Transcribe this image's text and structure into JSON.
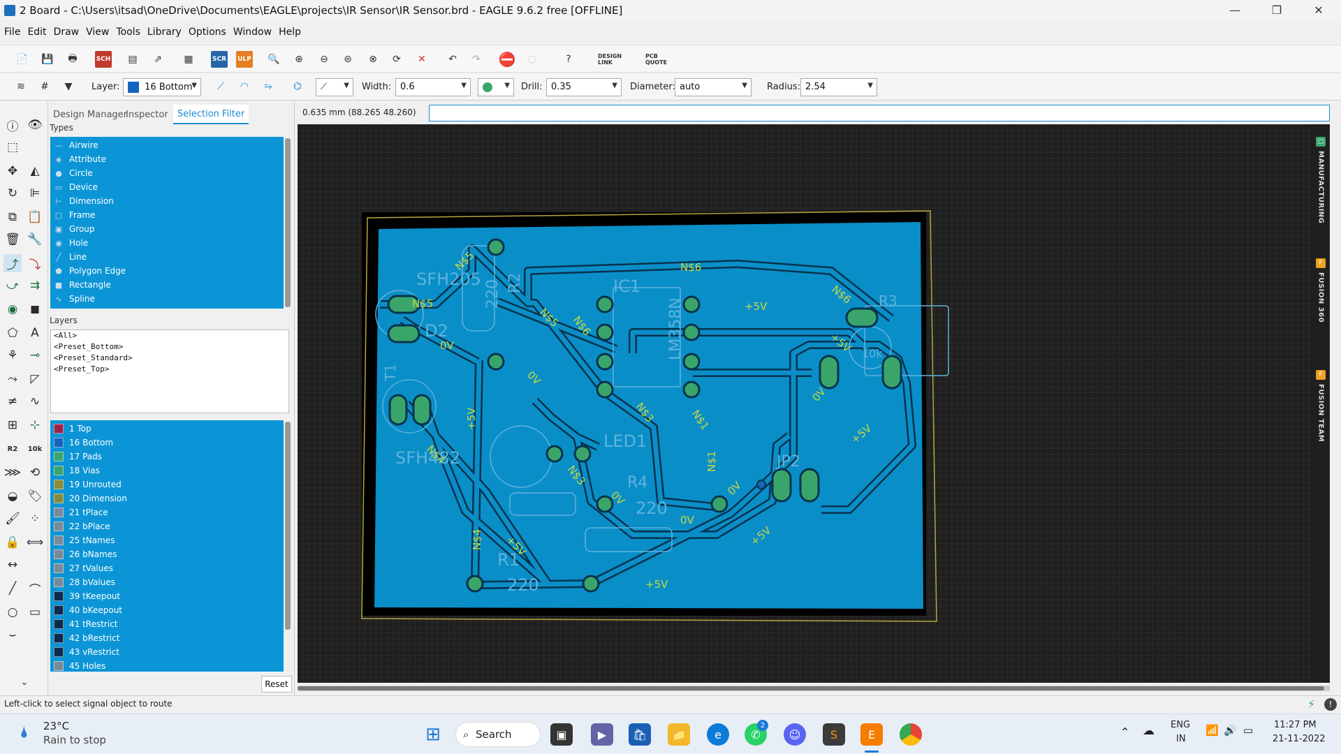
{
  "window": {
    "title": "2 Board - C:\\Users\\itsad\\OneDrive\\Documents\\EAGLE\\projects\\IR Sensor\\IR Sensor.brd - EAGLE 9.6.2 free [OFFLINE]",
    "minimize": "—",
    "maximize": "❐",
    "close": "✕"
  },
  "menu": [
    "File",
    "Edit",
    "Draw",
    "View",
    "Tools",
    "Library",
    "Options",
    "Window",
    "Help"
  ],
  "toolbar": {
    "scr": "SCR",
    "ulp": "ULP",
    "sch": "SCH",
    "design_link": "DESIGN LINK",
    "pcb_quote": "PCB QUOTE",
    "help": "?"
  },
  "params": {
    "layer_label": "Layer:",
    "layer_value": "16 Bottom",
    "layer_color": "#1565c0",
    "width_label": "Width:",
    "width_value": "0.6",
    "drill_label": "Drill:",
    "drill_value": "0.35",
    "diameter_label": "Diameter:",
    "diameter_value": "auto",
    "radius_label": "Radius:",
    "radius_value": "2.54"
  },
  "panel": {
    "tabs": [
      "Design Manager",
      "Inspector",
      "Selection Filter"
    ],
    "types_title": "Types",
    "types": [
      {
        "label": "Airwire",
        "icon": "—"
      },
      {
        "label": "Attribute",
        "icon": "◈"
      },
      {
        "label": "Circle",
        "icon": "●"
      },
      {
        "label": "Device",
        "icon": "▭"
      },
      {
        "label": "Dimension",
        "icon": "⊢"
      },
      {
        "label": "Frame",
        "icon": "▢"
      },
      {
        "label": "Group",
        "icon": "▣"
      },
      {
        "label": "Hole",
        "icon": "◉"
      },
      {
        "label": "Line",
        "icon": "╱"
      },
      {
        "label": "Polygon Edge",
        "icon": "⬟"
      },
      {
        "label": "Rectangle",
        "icon": "■"
      },
      {
        "label": "Spline",
        "icon": "∿"
      }
    ],
    "layers_title": "Layers",
    "presets": [
      "<All>",
      "<Preset_Bottom>",
      "<Preset_Standard>",
      "<Preset_Top>"
    ],
    "layers": [
      {
        "label": "1 Top",
        "color": "#a0204a"
      },
      {
        "label": "16 Bottom",
        "color": "#1565c0"
      },
      {
        "label": "17 Pads",
        "color": "#3aa56b"
      },
      {
        "label": "18 Vias",
        "color": "#3aa56b"
      },
      {
        "label": "19 Unrouted",
        "color": "#8a8a3a"
      },
      {
        "label": "20 Dimension",
        "color": "#8a8a3a"
      },
      {
        "label": "21 tPlace",
        "color": "#7a8a9a"
      },
      {
        "label": "22 bPlace",
        "color": "#7a8a9a"
      },
      {
        "label": "25 tNames",
        "color": "#7a8a9a"
      },
      {
        "label": "26 bNames",
        "color": "#7a8a9a"
      },
      {
        "label": "27 tValues",
        "color": "#7a8a9a"
      },
      {
        "label": "28 bValues",
        "color": "#7a8a9a"
      },
      {
        "label": "39 tKeepout",
        "color": "#0d2b4a"
      },
      {
        "label": "40 bKeepout",
        "color": "#0d2b4a"
      },
      {
        "label": "41 tRestrict",
        "color": "#0d2b4a"
      },
      {
        "label": "42 bRestrict",
        "color": "#0d2b4a"
      },
      {
        "label": "43 vRestrict",
        "color": "#0d2b4a"
      },
      {
        "label": "45 Holes",
        "color": "#7a8a9a"
      }
    ],
    "reset": "Reset"
  },
  "coord": "0.635 mm (88.265 48.260)",
  "side_tabs": [
    {
      "label": "MANUFACTURING",
      "badge": "▢",
      "color": "#3aa56b"
    },
    {
      "label": "FUSION 360",
      "badge": "F",
      "color": "#f0a020"
    },
    {
      "label": "FUSION TEAM",
      "badge": "F",
      "color": "#f0a020"
    }
  ],
  "board": {
    "labels": {
      "sfh205": "SFH205",
      "d2": "D2",
      "ic1": "IC1",
      "lm358n": "LM358N",
      "r2": "R2",
      "r2_value": "220",
      "led1": "LED1",
      "r4": "R4",
      "r4_value": "220",
      "jp2": "JP2",
      "r1": "R1",
      "r1_value": "220",
      "sfh482": "SFH482",
      "r3": "R3",
      "r3_value": "10k",
      "t1": "T1",
      "n5_a": "N$5",
      "n5_b": "N$5",
      "n5_c": "N$5",
      "n6_a": "N$6",
      "n6_b": "N$6",
      "n6_c": "N$6",
      "n3_a": "N$3",
      "n3_b": "N$3",
      "n1_a": "N$1",
      "n1_b": "N$1",
      "n4_a": "N$4",
      "n4_b": "N$4",
      "v0_a": "0V",
      "v0_b": "0V",
      "v0_c": "0V",
      "v0_d": "0V",
      "v0_e": "0V",
      "v0_f": "0V",
      "p5_a": "+5V",
      "p5_b": "+5V",
      "p5_c": "+5V",
      "p5_d": "+5V",
      "p5_e": "+5V",
      "p5_f": "+5V",
      "p5_g": "+5V"
    }
  },
  "status": "Left-click to select signal object to route",
  "taskbar": {
    "weather_temp": "23°C",
    "weather_text": "Rain to stop",
    "search": "Search",
    "lang1": "ENG",
    "lang2": "IN",
    "time": "11:27 PM",
    "date": "21-11-2022",
    "whatsapp_badge": "2"
  }
}
